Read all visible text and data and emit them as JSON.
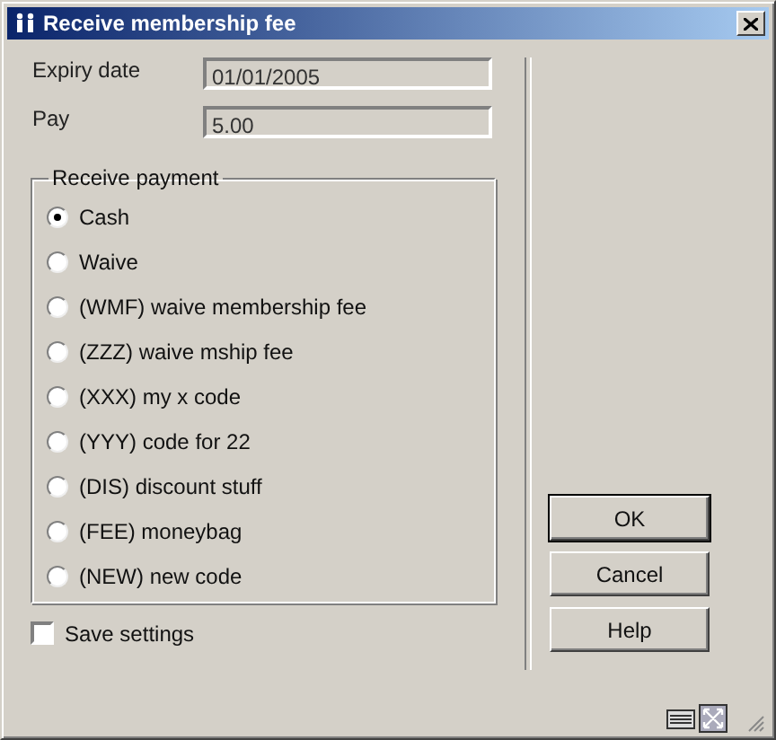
{
  "window": {
    "title": "Receive membership fee"
  },
  "fields": [
    {
      "label": "Expiry date",
      "value": "01/01/2005"
    },
    {
      "label": "Pay",
      "value": "5.00"
    }
  ],
  "payment_group": {
    "title": "Receive payment",
    "options": [
      {
        "label": "Cash",
        "selected": true
      },
      {
        "label": "Waive",
        "selected": false
      },
      {
        "label": "(WMF) waive membership fee",
        "selected": false
      },
      {
        "label": "(ZZZ) waive mship fee",
        "selected": false
      },
      {
        "label": "(XXX) my x code",
        "selected": false
      },
      {
        "label": "(YYY) code for 22",
        "selected": false
      },
      {
        "label": "(DIS) discount stuff",
        "selected": false
      },
      {
        "label": "(FEE) moneybag",
        "selected": false
      },
      {
        "label": "(NEW) new code",
        "selected": false
      }
    ]
  },
  "save_settings": {
    "label": "Save settings",
    "checked": false
  },
  "buttons": [
    {
      "label": "OK",
      "default": true
    },
    {
      "label": "Cancel",
      "default": false
    },
    {
      "label": "Help",
      "default": false
    }
  ]
}
